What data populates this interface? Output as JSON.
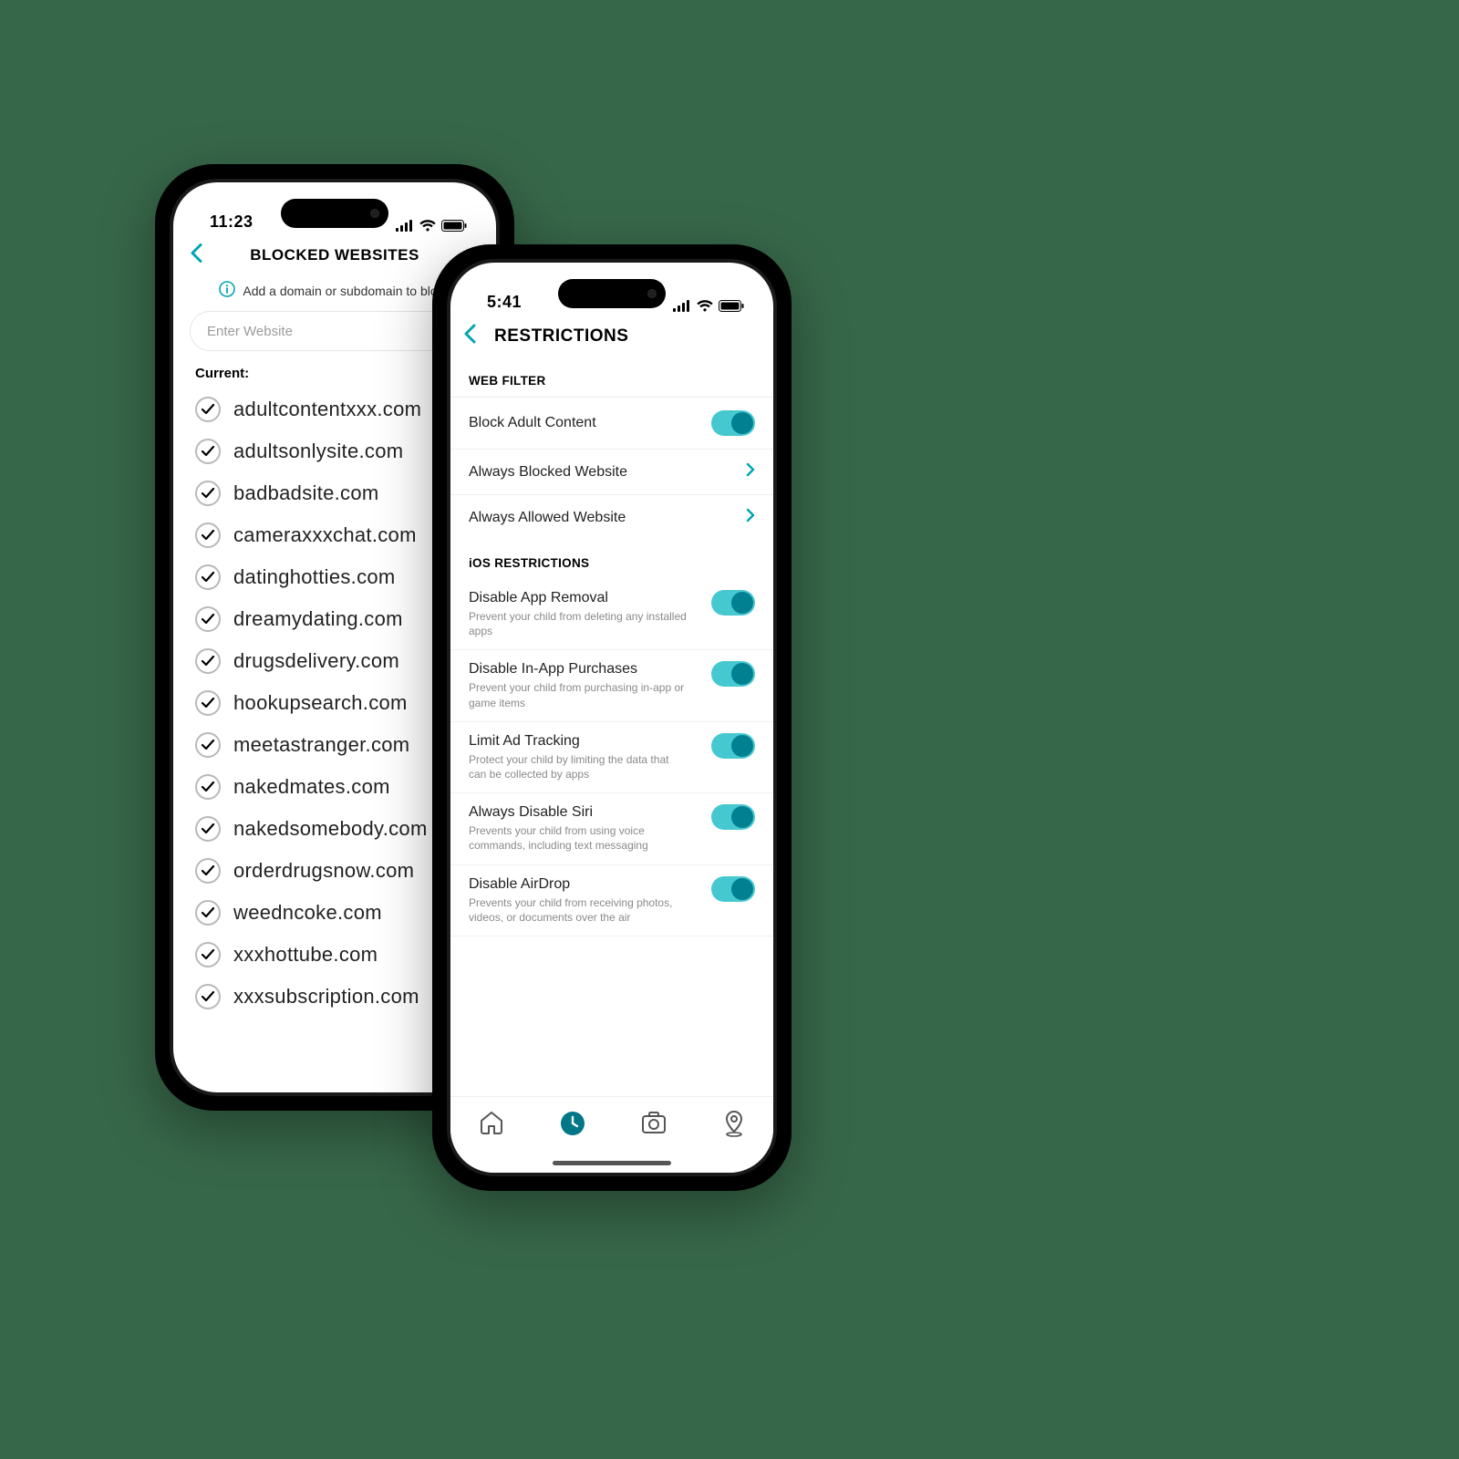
{
  "colors": {
    "accent": "#00a4b4",
    "toggle": "#46c8d1"
  },
  "phone1": {
    "status_time": "11:23",
    "title": "BLOCKED WEBSITES",
    "hint": "Add a domain or subdomain to block",
    "input_placeholder": "Enter Website",
    "current_label": "Current:",
    "domains": [
      "adultcontentxxx.com",
      "adultsonlysite.com",
      "badbadsite.com",
      "cameraxxxchat.com",
      "datinghotties.com",
      "dreamydating.com",
      "drugsdelivery.com",
      "hookupsearch.com",
      "meetastranger.com",
      "nakedmates.com",
      "nakedsomebody.com",
      "orderdrugsnow.com",
      "weedncoke.com",
      "xxxhottube.com",
      "xxxsubscription.com"
    ]
  },
  "phone2": {
    "status_time": "5:41",
    "title": "RESTRICTIONS",
    "section_web": "WEB FILTER",
    "row_block_adult": "Block Adult Content",
    "row_always_blocked": "Always Blocked Website",
    "row_always_allowed": "Always Allowed Website",
    "section_ios": "iOS RESTRICTIONS",
    "restrictions": [
      {
        "label": "Disable App Removal",
        "sub": "Prevent your child from deleting any installed apps"
      },
      {
        "label": "Disable In-App Purchases",
        "sub": "Prevent your child from purchasing in-app or game items"
      },
      {
        "label": "Limit Ad Tracking",
        "sub": "Protect your child by limiting the data that can be collected by apps"
      },
      {
        "label": "Always Disable Siri",
        "sub": "Prevents your child from using voice commands, including text messaging"
      },
      {
        "label": "Disable AirDrop",
        "sub": "Prevents your child from receiving photos, videos, or documents over the air"
      }
    ],
    "nav": {
      "home": "home-icon",
      "time": "clock-icon",
      "camera": "camera-icon",
      "location": "location-icon"
    }
  }
}
